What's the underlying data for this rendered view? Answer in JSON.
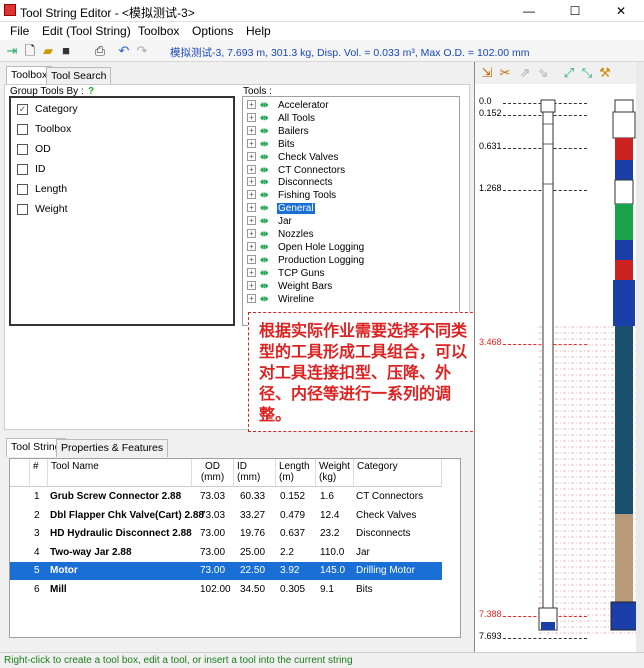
{
  "window": {
    "title": "Tool String Editor - <模拟测试-3>",
    "minimize": "—",
    "maximize": "☐",
    "close": "✕"
  },
  "menu": [
    "File",
    "Edit (Tool String)",
    "Toolbox",
    "Options",
    "Help"
  ],
  "toolbar": {
    "icons": [
      "new-string-icon",
      "new-file-icon",
      "open-folder-icon",
      "save-icon",
      "print-icon",
      "undo-icon",
      "redo-icon"
    ],
    "info": "模拟测试-3, 7.693 m, 301.3 kg, Disp. Vol. = 0.033 m³, Max O.D. = 102.00 mm"
  },
  "left_tabs": {
    "toolbox": "Toolbox",
    "tool_search": "Tool Search"
  },
  "group_by": {
    "label": "Group Tools By :",
    "help": "?",
    "options": [
      {
        "label": "Category",
        "checked": true
      },
      {
        "label": "Toolbox",
        "checked": false
      },
      {
        "label": "OD",
        "checked": false
      },
      {
        "label": "ID",
        "checked": false
      },
      {
        "label": "Length",
        "checked": false
      },
      {
        "label": "Weight",
        "checked": false
      }
    ]
  },
  "tools": {
    "label": "Tools :",
    "items": [
      "Accelerator",
      "All Tools",
      "Bailers",
      "Bits",
      "Check Valves",
      "CT Connectors",
      "Disconnects",
      "Fishing Tools",
      "General",
      "Jar",
      "Nozzles",
      "Open Hole Logging",
      "Production Logging",
      "TCP Guns",
      "Weight Bars",
      "Wireline"
    ],
    "selected": "General"
  },
  "annotation": "根据实际作业需要选择不同类型的工具形成工具组合，可以对工具连接扣型、压降、外径、内径等进行一系列的调整。",
  "bottom_tabs": {
    "tool_string": "Tool String",
    "properties": "Properties & Features"
  },
  "table": {
    "headers": [
      "#",
      "Tool Name",
      "OD\n(mm)",
      "ID (mm)",
      "Length\n(m)",
      "Weight\n(kg)",
      "Category"
    ],
    "rows": [
      [
        "1",
        "Grub Screw Connector 2.88",
        "73.03",
        "60.33",
        "0.152",
        "1.6",
        "CT Connectors"
      ],
      [
        "2",
        "Dbl Flapper Chk Valve(Cart) 2.88",
        "73.03",
        "33.27",
        "0.479",
        "12.4",
        "Check Valves"
      ],
      [
        "3",
        "HD Hydraulic Disconnect 2.88",
        "73.00",
        "19.76",
        "0.637",
        "23.2",
        "Disconnects"
      ],
      [
        "4",
        "Two-way Jar 2.88",
        "73.00",
        "25.00",
        "2.2",
        "110.0",
        "Jar"
      ],
      [
        "5",
        "Motor",
        "73.00",
        "22.50",
        "3.92",
        "145.0",
        "Drilling Motor"
      ],
      [
        "6",
        "Mill",
        "102.00",
        "34.50",
        "0.305",
        "9.1",
        "Bits"
      ]
    ],
    "selected_row": 4
  },
  "depth_scale": {
    "marks": [
      "0.0",
      "0.152",
      "0.631",
      "1.268",
      "3.468",
      "7.388",
      "7.693"
    ],
    "red_marks": [
      "3.468",
      "7.388"
    ]
  },
  "right_toolbar_icons": [
    "insert-tool-icon",
    "delete-tool-icon",
    "move-up-icon",
    "move-down-icon",
    "zoom-in-icon",
    "zoom-out-icon",
    "wrench-icon"
  ],
  "status": "Right-click to create a tool box, edit a tool, or insert a tool into the current string",
  "colors": {
    "accent": "#1a6fd6",
    "annotation": "#d22222",
    "info_text": "#1a47b8",
    "status_text": "#1a7d1a"
  }
}
